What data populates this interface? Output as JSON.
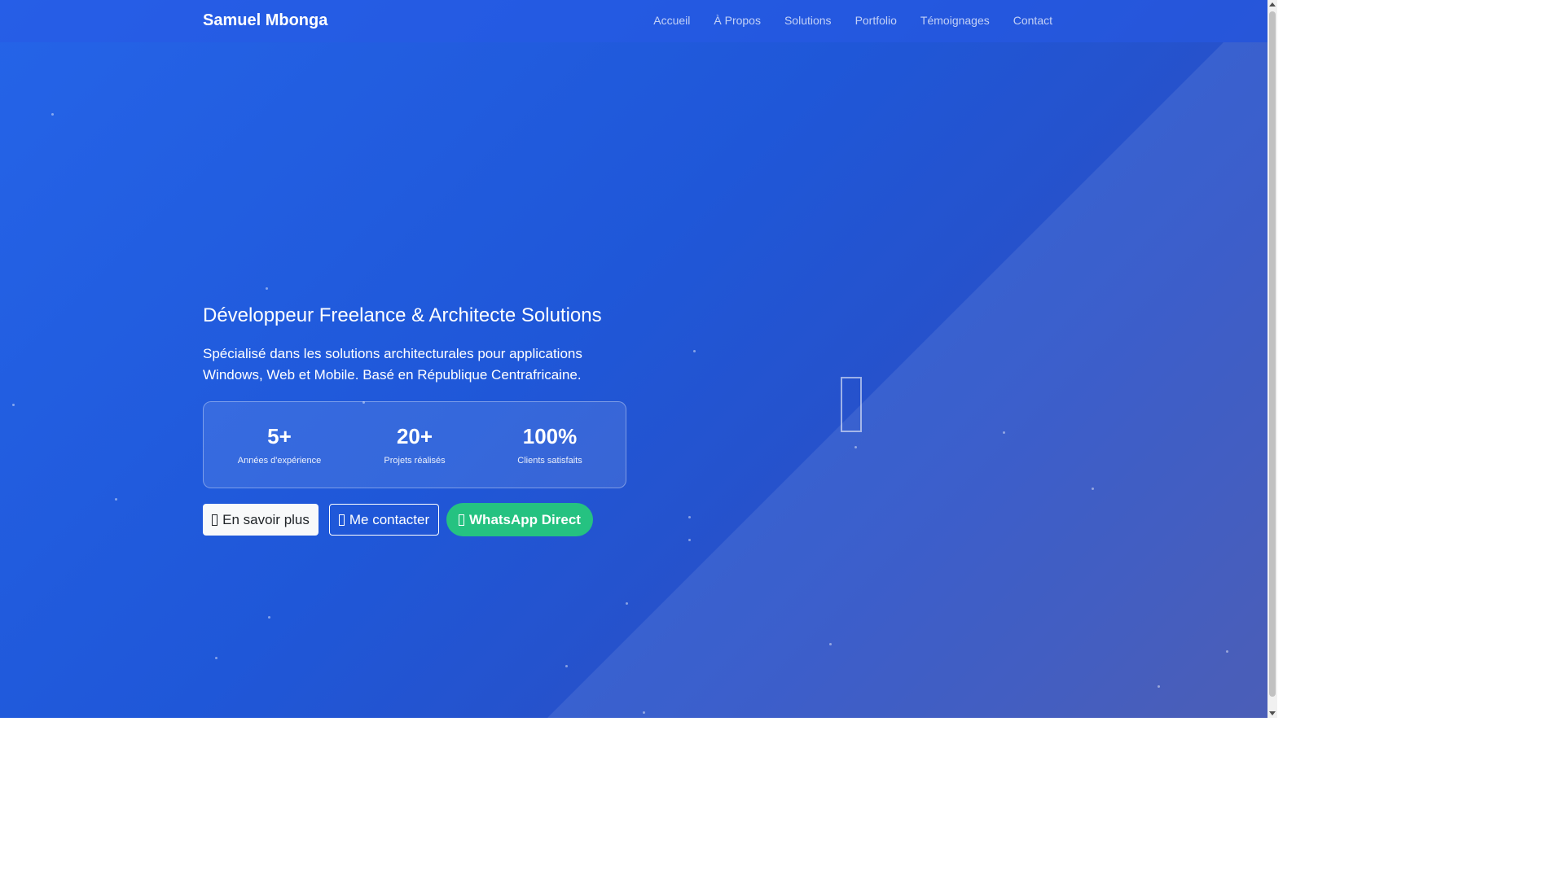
{
  "navbar": {
    "brand": "Samuel Mbonga",
    "links": [
      "Accueil",
      "À Propos",
      "Solutions",
      "Portfolio",
      "Témoignages",
      "Contact"
    ]
  },
  "hero": {
    "title": "Développeur Freelance & Architecte Solutions",
    "description": "Spécialisé dans les solutions architecturales pour applications Windows, Web et Mobile. Basé en République Centrafricaine.",
    "stats": [
      {
        "value": "5+",
        "label": "Années d'expérience"
      },
      {
        "value": "20+",
        "label": "Projets réalisés"
      },
      {
        "value": "100%",
        "label": "Clients satisfaits"
      }
    ],
    "buttons": {
      "learn_more": "En savoir plus",
      "contact": "Me contacter",
      "whatsapp": "WhatsApp Direct"
    },
    "icon": "code-icon"
  },
  "colors": {
    "background_start": "#2564e8",
    "background_end": "#3a4fb0",
    "whatsapp": "#25c281"
  }
}
